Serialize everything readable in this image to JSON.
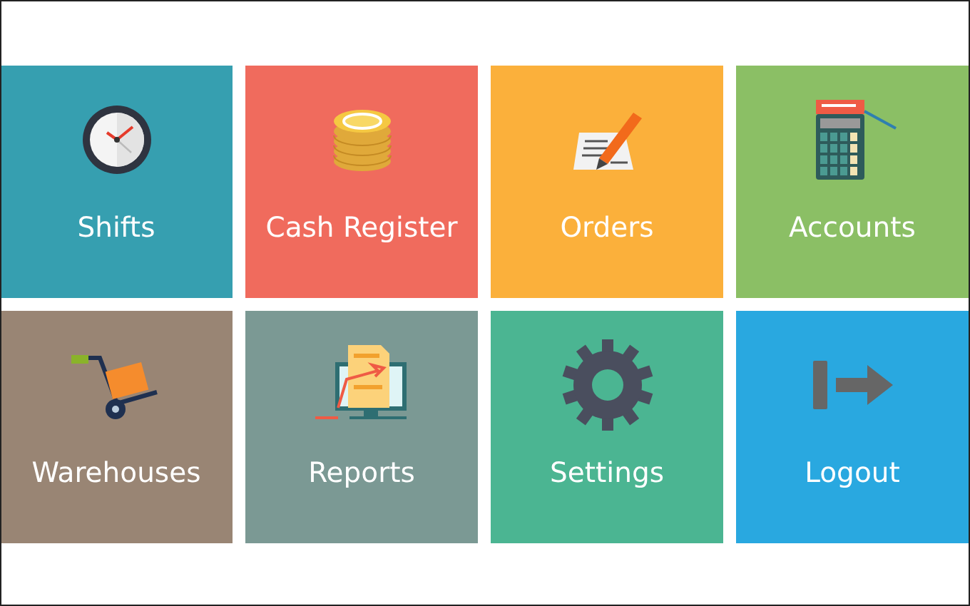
{
  "tiles": [
    {
      "label": "Shifts",
      "color": "#369fb0"
    },
    {
      "label": "Cash Register",
      "color": "#f06b5d"
    },
    {
      "label": "Orders",
      "color": "#fbb03b"
    },
    {
      "label": "Accounts",
      "color": "#8bbf65"
    },
    {
      "label": "Warehouses",
      "color": "#998574"
    },
    {
      "label": "Reports",
      "color": "#7b9994"
    },
    {
      "label": "Settings",
      "color": "#4bb592"
    },
    {
      "label": "Logout",
      "color": "#29a8e0"
    }
  ]
}
